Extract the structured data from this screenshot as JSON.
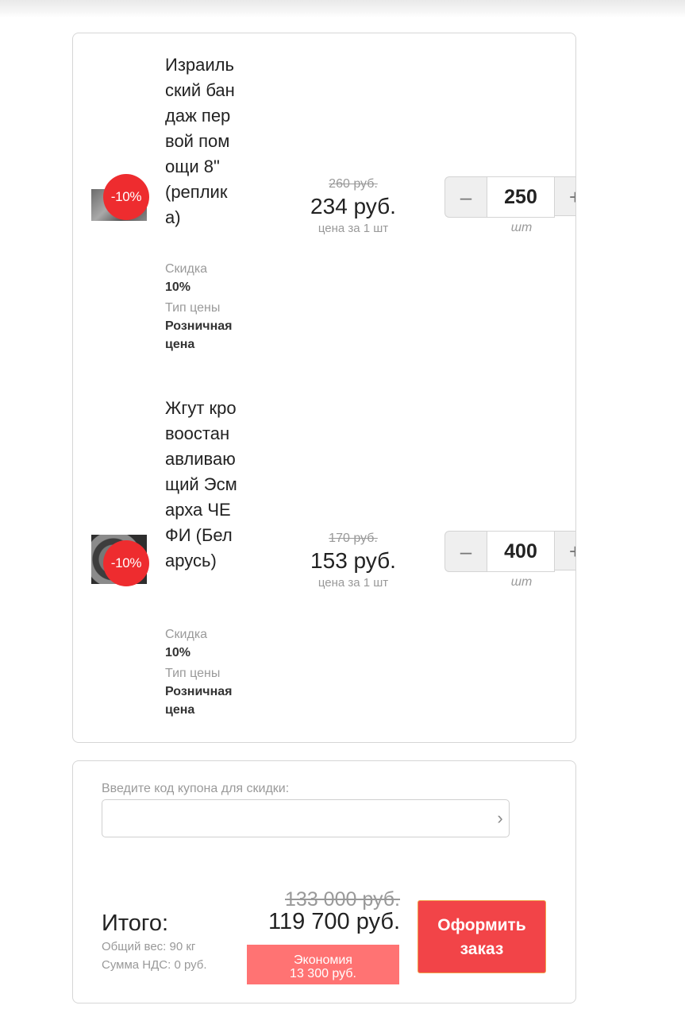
{
  "items": [
    {
      "name": "Израильский бандаж первой помощи 8\" (реплика)",
      "badge": "-10%",
      "discount_label": "Скидка",
      "discount_value": "10%",
      "price_type_label": "Тип цены",
      "price_type_value": "Розничная цена",
      "old_price": "260 руб.",
      "price": "234 руб.",
      "per_unit": "цена за 1 шт",
      "quantity": "250",
      "unit": "шт",
      "minus": "–",
      "plus": "+"
    },
    {
      "name": "Жгут кровоостанавливающий Эсмарха ЧЕФИ (Беларусь)",
      "badge": "-10%",
      "discount_label": "Скидка",
      "discount_value": "10%",
      "price_type_label": "Тип цены",
      "price_type_value": "Розничная цена",
      "old_price": "170 руб.",
      "price": "153 руб.",
      "per_unit": "цена за 1 шт",
      "quantity": "400",
      "unit": "шт",
      "minus": "–",
      "plus": "+"
    }
  ],
  "coupon": {
    "label": "Введите код купона для скидки:",
    "value": "",
    "arrow_icon": "chevron-right-icon"
  },
  "summary": {
    "total_label": "Итого:",
    "weight": "Общий вес: 90 кг",
    "vat": "Сумма НДС: 0 руб.",
    "old_total": "133 000 руб.",
    "total": "119 700 руб.",
    "economy_label": "Экономия",
    "economy_value": "13 300 руб."
  },
  "checkout": {
    "label_line1": "Оформить",
    "label_line2": "заказ"
  },
  "colors": {
    "badge": "#ee2c2f",
    "checkout": "#f24448",
    "economy": "#ff7373"
  }
}
